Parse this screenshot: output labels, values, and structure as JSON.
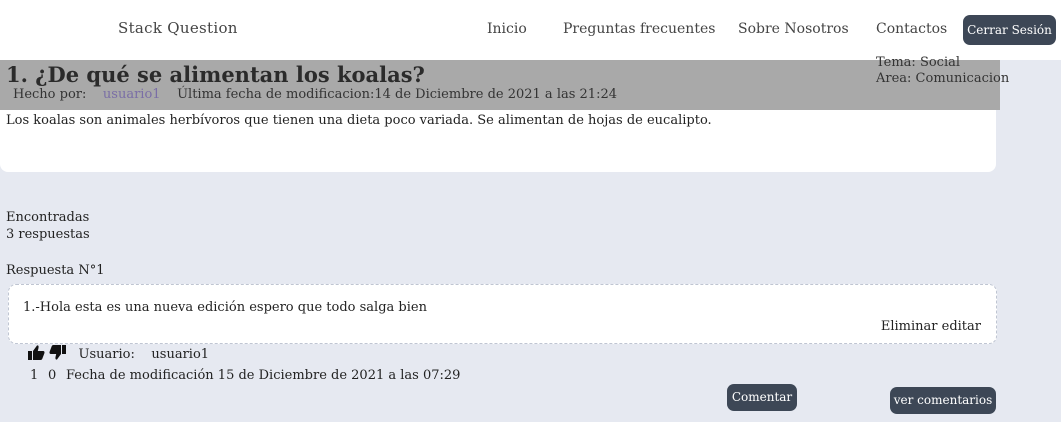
{
  "navbar": {
    "brand": "Stack Question",
    "links": [
      "Inicio",
      "Preguntas frecuentes",
      "Sobre Nosotros",
      "Contactos"
    ],
    "logout_label": "Cerrar Sesión"
  },
  "question": {
    "title": "1. ¿De qué se alimentan los koalas?",
    "author_label": "Hecho por:",
    "author": "usuario1",
    "modified_label": "Última fecha de modificacion:",
    "modified_date": "14 de Diciembre de 2021 a las 21:24",
    "topic": "Tema: Social",
    "area": "Area: Comunicacion",
    "body": "Los koalas son animales herbívoros que tienen una dieta poco variada. Se alimentan de hojas de eucalipto."
  },
  "answers_summary": {
    "found_label": "Encontradas",
    "count_text": "3 respuestas"
  },
  "answer": {
    "label": "Respuesta N°1",
    "text": "1.-Hola esta es una nueva edición espero que todo salga bien",
    "delete_label": "Eliminar",
    "edit_label": "editar",
    "user_label": "Usuario:",
    "user": "usuario1",
    "likes": "1",
    "dislikes": "0",
    "modified_text": "Fecha de modificación 15 de Diciembre de 2021 a las 07:29",
    "comment_label": "Comentar",
    "view_comments_label": "ver comentarios"
  },
  "icons": {
    "like": "thumbs-up-icon",
    "dislike": "thumbs-down-icon"
  },
  "colors": {
    "background": "#e6e9f1",
    "header_gray": "#a9a9a9",
    "button_dark": "#3d4756",
    "user_link": "#7a6ea6"
  }
}
